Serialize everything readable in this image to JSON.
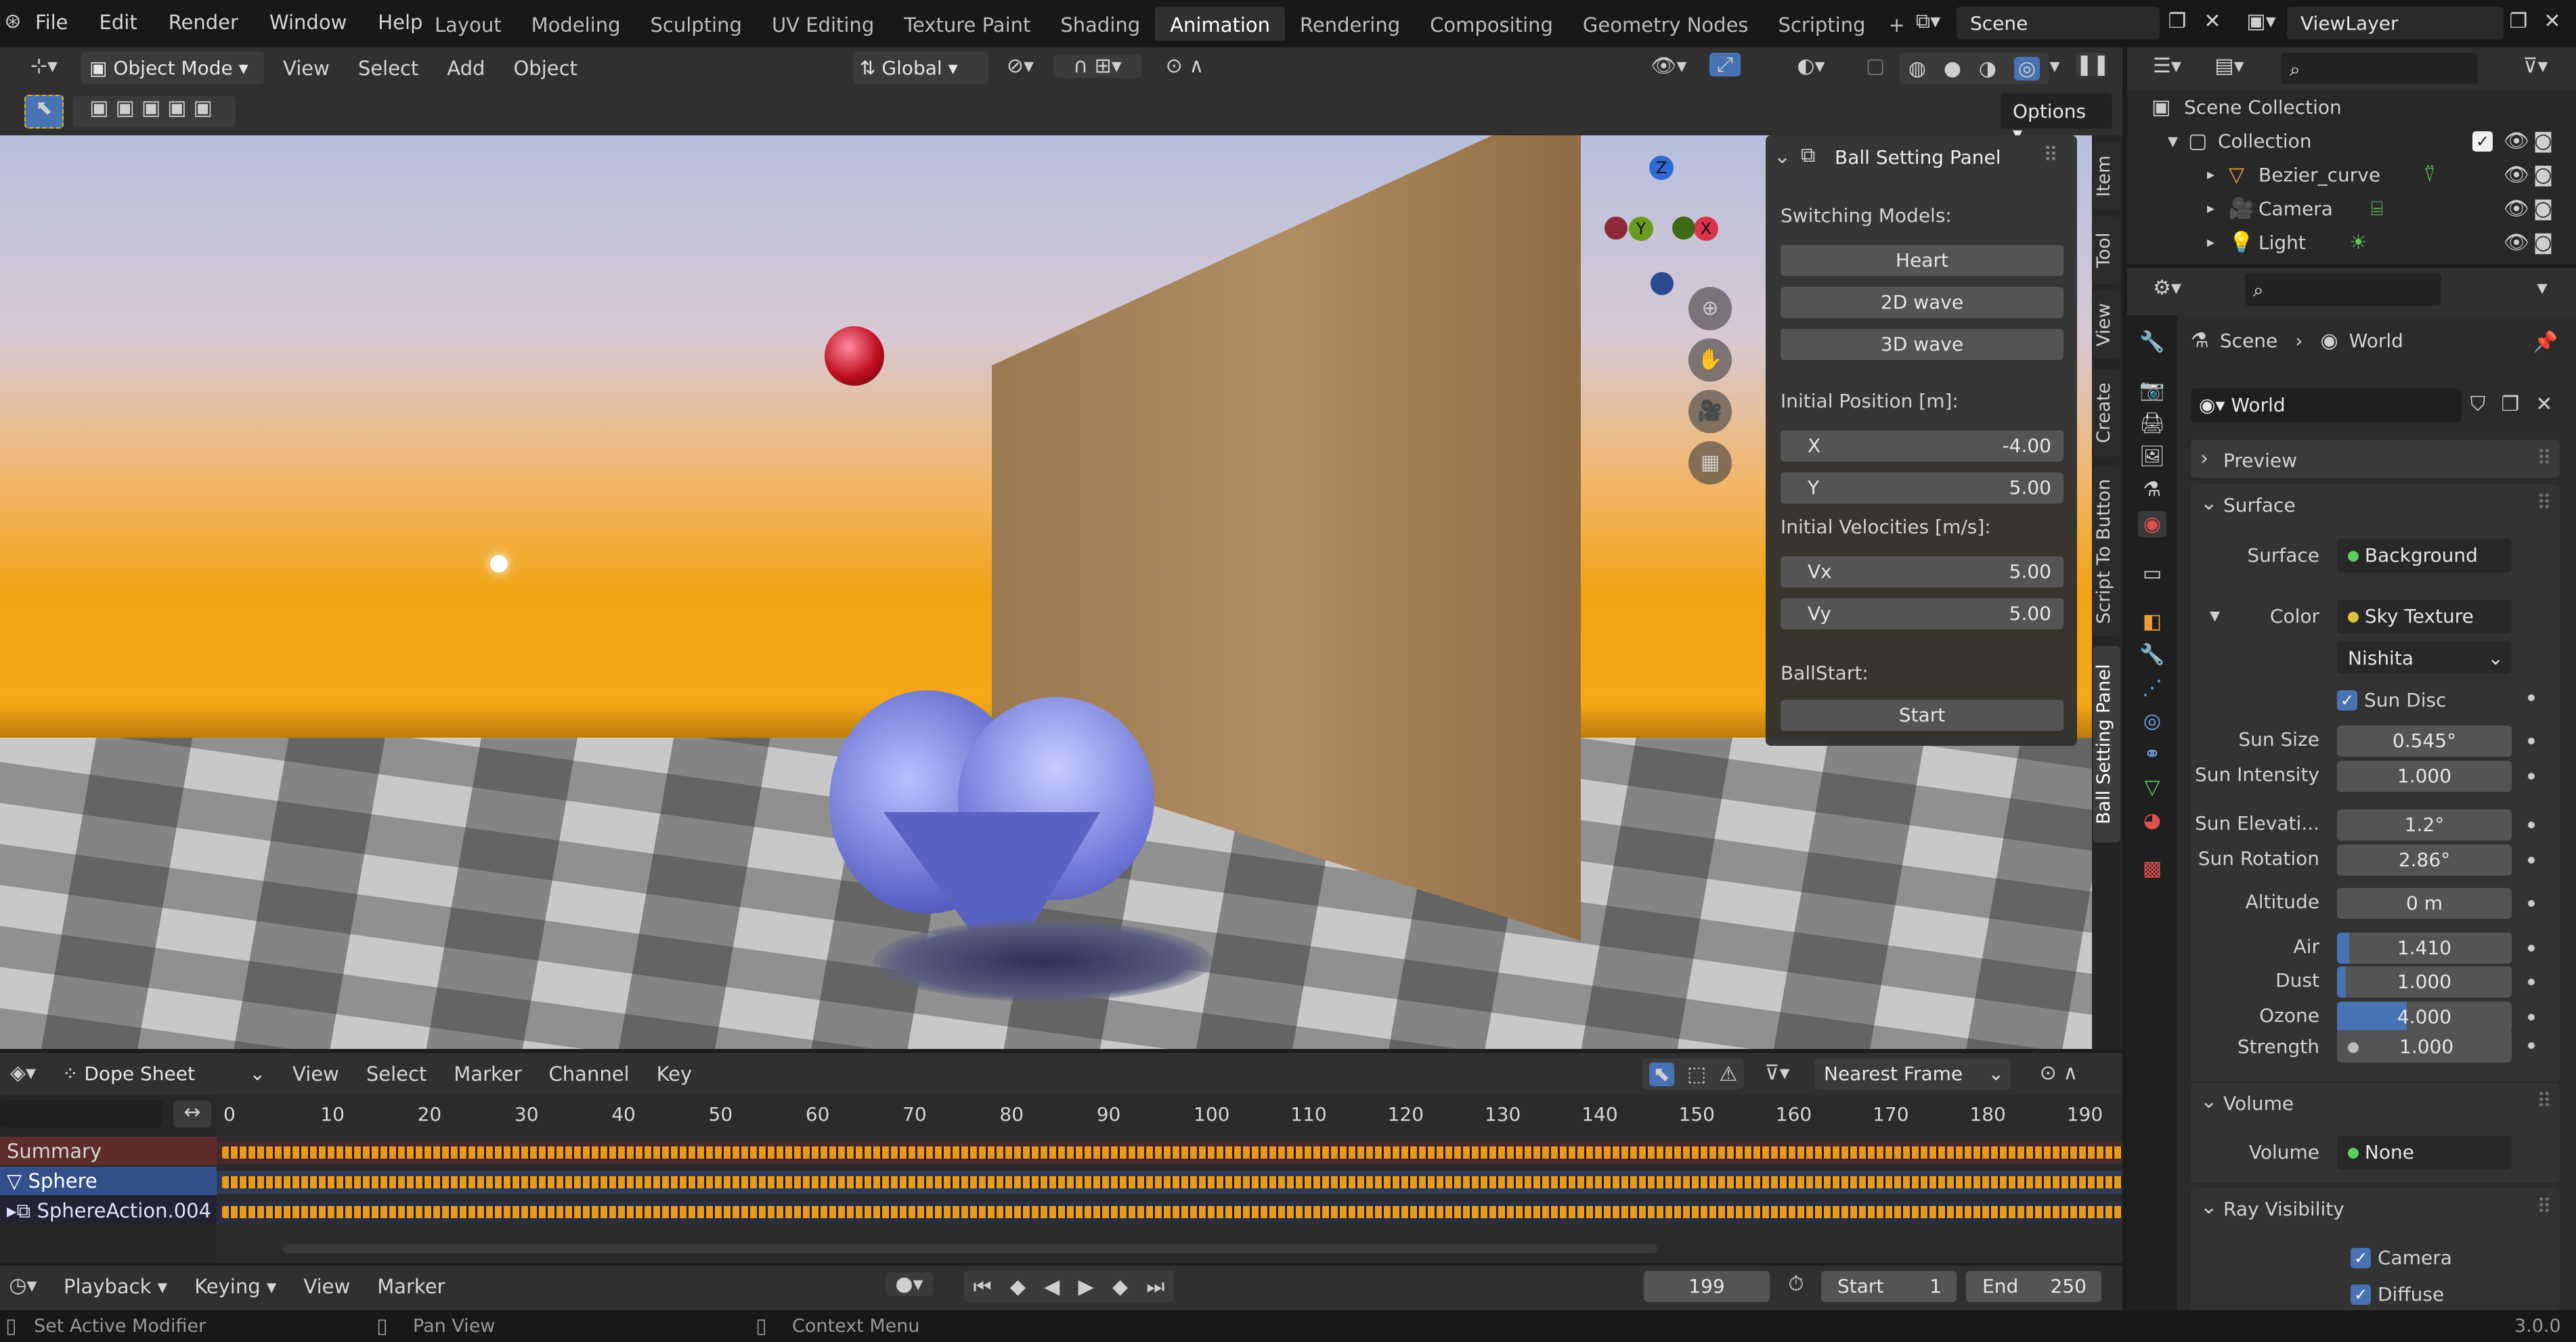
{
  "menubar": {
    "items": [
      "File",
      "Edit",
      "Render",
      "Window",
      "Help"
    ],
    "workspaces": [
      "Layout",
      "Modeling",
      "Sculpting",
      "UV Editing",
      "Texture Paint",
      "Shading",
      "Animation",
      "Rendering",
      "Compositing",
      "Geometry Nodes",
      "Scripting"
    ],
    "active_workspace": "Animation",
    "add": "+",
    "scene": "Scene",
    "viewlayer": "ViewLayer"
  },
  "viewport_header": {
    "mode": "Object Mode",
    "menus": [
      "View",
      "Select",
      "Add",
      "Object"
    ],
    "orientation": "Global",
    "options": "Options"
  },
  "ball_panel": {
    "title": "Ball Setting Panel",
    "switching": "Switching Models:",
    "models": [
      "Heart",
      "2D wave",
      "3D wave"
    ],
    "init_pos": "Initial Position [m]:",
    "x_label": "X",
    "x_value": "-4.00",
    "y_label": "Y",
    "y_value": "5.00",
    "init_vel": "Initial Velocities [m/s]:",
    "vx_label": "Vx",
    "vx_value": "5.00",
    "vy_label": "Vy",
    "vy_value": "5.00",
    "ballstart": "BallStart:",
    "start": "Start"
  },
  "side_tabs": [
    "Item",
    "Tool",
    "View",
    "Create",
    "Script To Button",
    "Ball Setting Panel"
  ],
  "gizmo": {
    "z": "Z",
    "y": "Y",
    "x": "X"
  },
  "outliner": {
    "root": "Scene Collection",
    "collection": "Collection",
    "items": [
      "Bezier_curve",
      "Camera",
      "Light"
    ]
  },
  "properties": {
    "breadcrumb_scene": "Scene",
    "breadcrumb_world": "World",
    "world_name": "World",
    "preview": "Preview",
    "surface_section": "Surface",
    "surface_label": "Surface",
    "surface_value": "Background",
    "color_label": "Color",
    "color_value": "Sky Texture",
    "sky_type": "Nishita",
    "sun_disc": "Sun Disc",
    "rows": [
      {
        "label": "Sun Size",
        "value": "0.545°"
      },
      {
        "label": "Sun Intensity",
        "value": "1.000"
      },
      {
        "label": "Sun Elevati...",
        "value": "1.2°"
      },
      {
        "label": "Sun Rotation",
        "value": "2.86°"
      },
      {
        "label": "Altitude",
        "value": "0 m"
      },
      {
        "label": "Air",
        "value": "1.410",
        "fill": 0.07
      },
      {
        "label": "Dust",
        "value": "1.000",
        "fill": 0.05
      },
      {
        "label": "Ozone",
        "value": "4.000",
        "fill": 0.4
      }
    ],
    "strength_label": "Strength",
    "strength_value": "1.000",
    "volume_section": "Volume",
    "volume_label": "Volume",
    "volume_value": "None",
    "ray_section": "Ray Visibility",
    "ray_camera": "Camera",
    "ray_diffuse": "Diffuse"
  },
  "dopesheet": {
    "mode": "Dope Sheet",
    "menus": [
      "View",
      "Select",
      "Marker",
      "Channel",
      "Key"
    ],
    "snap": "Nearest Frame",
    "ticks": [
      "0",
      "10",
      "20",
      "30",
      "40",
      "50",
      "60",
      "70",
      "80",
      "90",
      "100",
      "110",
      "120",
      "130",
      "140",
      "150",
      "160",
      "170",
      "180",
      "190"
    ],
    "channels": [
      "Summary",
      "Sphere",
      "SphereAction.004"
    ]
  },
  "timeline": {
    "menus": [
      "Playback",
      "Keying",
      "View",
      "Marker"
    ],
    "current": "199",
    "start_label": "Start",
    "start": "1",
    "end_label": "End",
    "end": "250"
  },
  "statusbar": {
    "left": "Set Active Modifier",
    "mid": "Pan View",
    "right": "Context Menu",
    "version": "3.0.0"
  },
  "colors": {
    "accent": "#4772b3",
    "keyframe": "#e89a1a",
    "summary": "#5f2c2c"
  }
}
